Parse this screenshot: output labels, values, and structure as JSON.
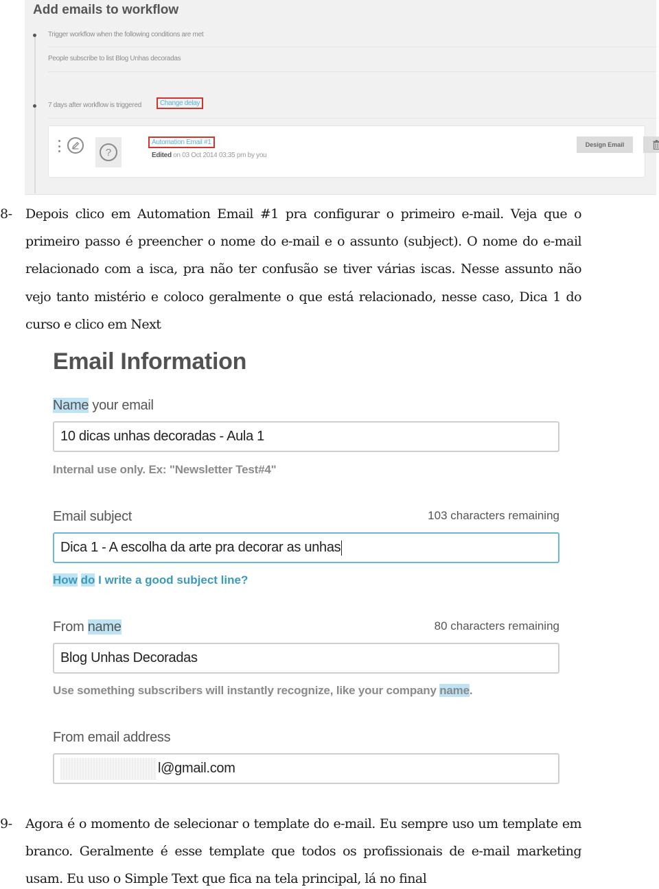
{
  "workflow_screenshot": {
    "title": "Add emails to workflow",
    "trigger": {
      "label": "Trigger workflow when the following conditions are met",
      "condition": "People subscribe to list Blog Unhas decoradas"
    },
    "delay": {
      "label": "7 days after workflow is triggered",
      "change_link": "Change delay"
    },
    "email_card": {
      "name_link": "Automation Email #1",
      "edited_bold": "Edited",
      "edited_rest": "on 03 Oct 2014 03:35 pm by you",
      "design_button": "Design Email",
      "delete_icon": "trash-icon",
      "edit_icon": "pencil-icon",
      "thumbnail_icon": "question-mark-icon",
      "drag_icon": "drag-handle-icon"
    },
    "highlight_box_color": "#d0342c",
    "link_color": "#5ab4d6"
  },
  "paragraphs": [
    {
      "number": "8-",
      "text": "Depois clico em Automation Email #1 pra configurar o primeiro e-mail. Veja que o primeiro passo é preencher o nome do e-mail e o assunto (subject). O nome do e-mail relacionado com a isca, pra não ter confusão se tiver várias iscas. Nesse assunto não vejo tanto mistério e coloco geralmente o que está relacionado, nesse caso, Dica 1 do curso e clico em Next"
    },
    {
      "number": "9-",
      "text": "Agora é o momento de selecionar o template do e-mail. Eu sempre uso um template em branco. Geralmente é esse template que todos os profissionais de e-mail marketing usam. Eu uso o Simple Text que fica na tela principal, lá no final"
    }
  ],
  "email_form": {
    "title": "Email Information",
    "name_field": {
      "label_highlight": "Name",
      "label_rest": " your email",
      "value": "10 dicas unhas decoradas - Aula 1",
      "help": "Internal use only. Ex: \"Newsletter Test#4\""
    },
    "subject_field": {
      "label": "Email subject",
      "counter": "103 characters remaining",
      "value": "Dica 1 - A escolha da arte pra decorar as unhas",
      "help_hl1": "How",
      "help_sp1": " ",
      "help_hl2": "do",
      "help_rest": " I write a good subject line?"
    },
    "from_name_field": {
      "label_rest": "From ",
      "label_highlight": "name",
      "counter": "80 characters remaining",
      "value": "Blog Unhas Decoradas",
      "help_rest": "Use something subscribers will instantly recognize, like your company ",
      "help_highlight": "name",
      "help_end": "."
    },
    "from_email_field": {
      "label": "From email address",
      "value_visible": "l@gmail.com"
    },
    "highlight_color": "#bde3f5",
    "focus_color": "#6ab8cf"
  }
}
